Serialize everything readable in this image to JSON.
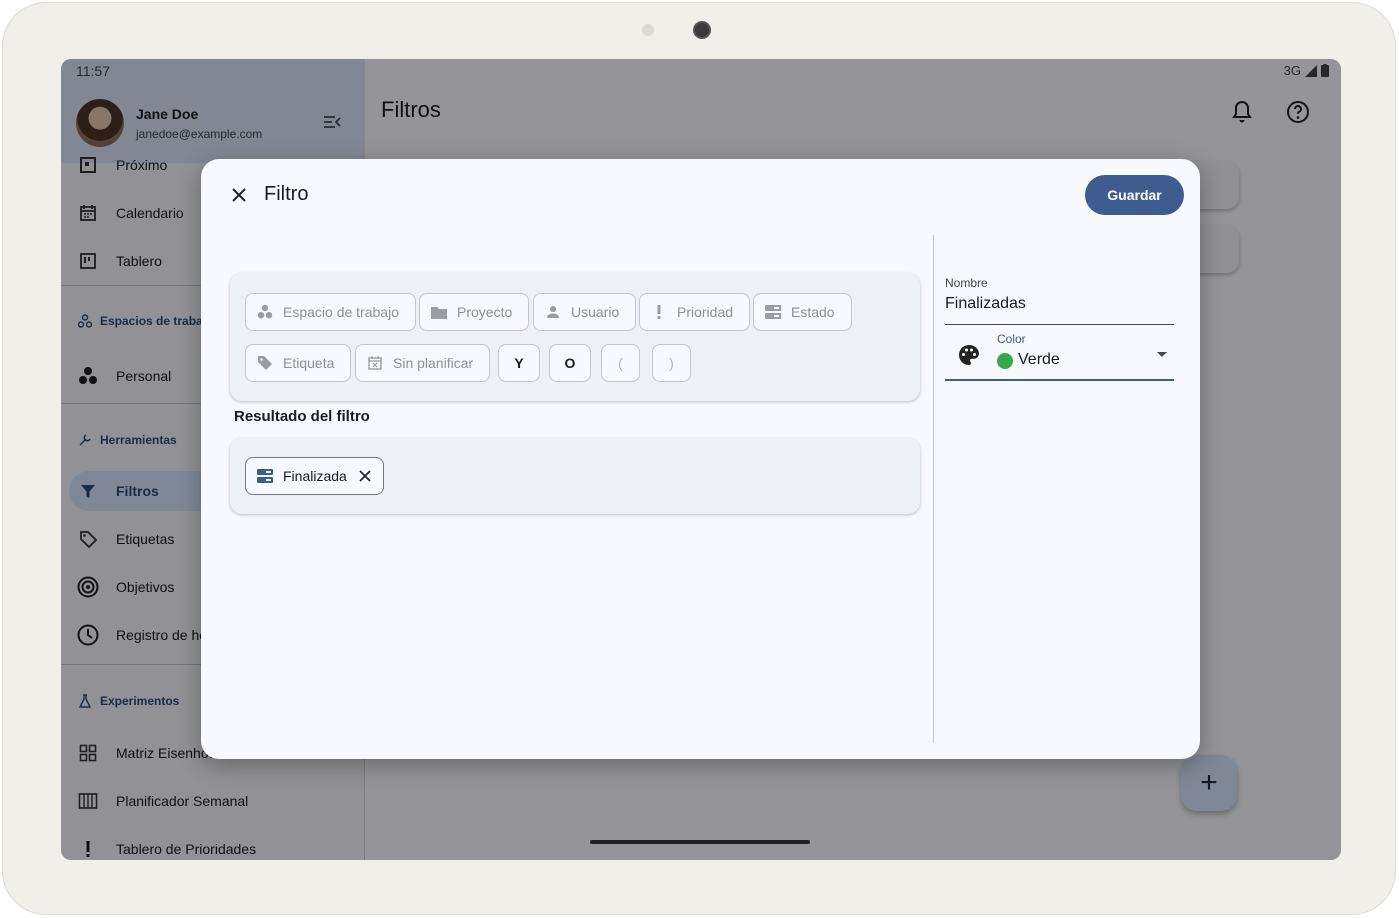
{
  "status": {
    "time": "11:57",
    "network": "3G"
  },
  "drawer": {
    "user_name": "Jane Doe",
    "user_email": "janedoe@example.com",
    "items": [
      {
        "label": "Próximo",
        "icon": "upcoming-icon"
      },
      {
        "label": "Calendario",
        "icon": "calendar-icon"
      },
      {
        "label": "Tablero",
        "icon": "board-icon"
      },
      {
        "label": "Personal",
        "icon": "workspace-icon"
      },
      {
        "label": "Filtros",
        "icon": "filter-icon"
      },
      {
        "label": "Etiquetas",
        "icon": "tag-icon"
      },
      {
        "label": "Objetivos",
        "icon": "target-icon"
      },
      {
        "label": "Registro de horas",
        "icon": "clock-icon"
      },
      {
        "label": "Matriz Eisenhower",
        "icon": "grid-icon"
      },
      {
        "label": "Planificador Semanal",
        "icon": "columns-icon"
      },
      {
        "label": "Tablero de Prioridades",
        "icon": "exclamation-icon"
      }
    ],
    "sections": {
      "workspaces": "Espacios de trabajo",
      "tools": "Herramientas",
      "experiments": "Experimentos"
    }
  },
  "appbar": {
    "title": "Filtros"
  },
  "dialog": {
    "title": "Filtro",
    "save_label": "Guardar",
    "chips_row1": [
      "Espacio de trabajo",
      "Proyecto",
      "Usuario",
      "Prioridad",
      "Estado"
    ],
    "chips_row2": [
      "Etiqueta",
      "Sin planificar"
    ],
    "operators": [
      "Y",
      "O",
      "(",
      ")"
    ],
    "result_label": "Resultado del filtro",
    "result_chips": [
      "Finalizada"
    ],
    "name_label": "Nombre",
    "name_value": "Finalizadas",
    "color_label": "Color",
    "color_value": "Verde",
    "color_hex": "#3aa64b",
    "accent": "#3e5c8f"
  }
}
